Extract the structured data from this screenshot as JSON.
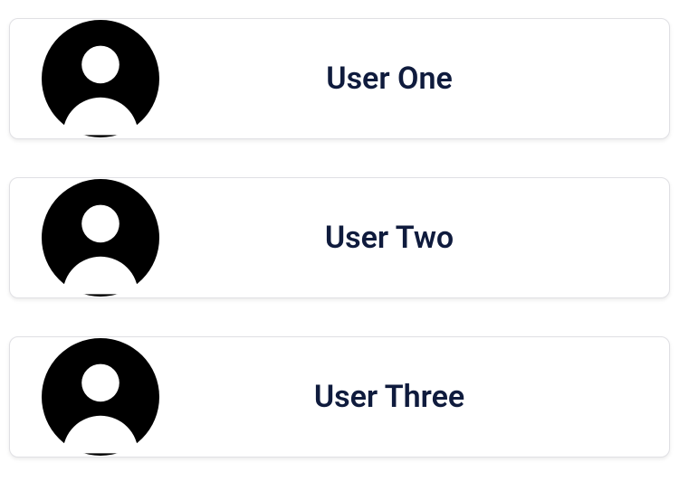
{
  "users": [
    {
      "name": "User One"
    },
    {
      "name": "User Two"
    },
    {
      "name": "User Three"
    }
  ],
  "colors": {
    "text": "#0f1b3d",
    "icon": "#000000"
  }
}
